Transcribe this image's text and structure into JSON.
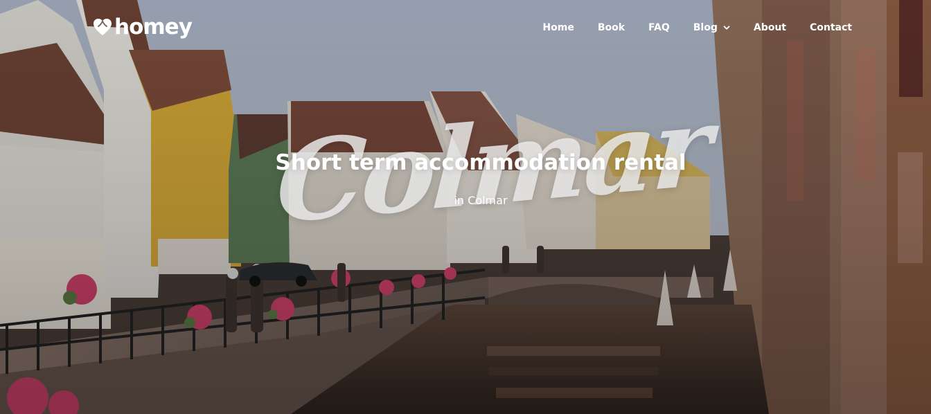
{
  "brand": {
    "name": "homey",
    "icon": "heart-logo-icon"
  },
  "nav": {
    "items": [
      {
        "label": "Home"
      },
      {
        "label": "Book"
      },
      {
        "label": "FAQ"
      },
      {
        "label": "Blog",
        "has_dropdown": true,
        "dropdown_icon": "chevron-down-icon"
      },
      {
        "label": "About"
      },
      {
        "label": "Contact"
      }
    ]
  },
  "hero": {
    "title": "Short term accommodation rental",
    "subtitle": "in Colmar",
    "script_text": "Colmar"
  },
  "colors": {
    "nav_text": "#ffffff",
    "title_text": "#ffffff",
    "script_text": "#e9e9e9",
    "sky": "#aeb7c8",
    "water": "#4c3a31"
  }
}
